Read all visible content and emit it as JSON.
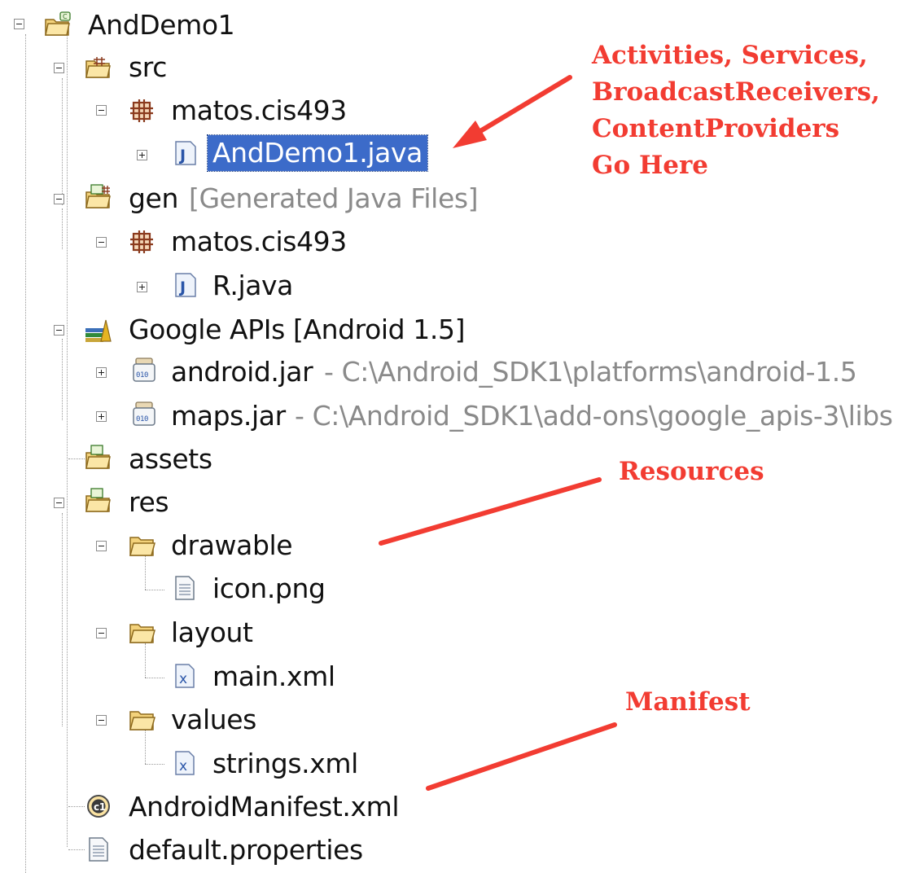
{
  "tree": {
    "project": "AndDemo1",
    "src": {
      "label": "src",
      "package": "matos.cis493",
      "file": "AndDemo1.java"
    },
    "gen": {
      "label": "gen",
      "decoration": "[Generated Java Files]",
      "package": "matos.cis493",
      "file": "R.java"
    },
    "library": {
      "label": "Google APIs [Android 1.5]",
      "jars": [
        {
          "name": "android.jar",
          "path": "- C:\\Android_SDK1\\platforms\\android-1.5"
        },
        {
          "name": "maps.jar",
          "path": "- C:\\Android_SDK1\\add-ons\\google_apis-3\\libs"
        }
      ]
    },
    "assets": "assets",
    "res": {
      "label": "res",
      "folders": [
        {
          "name": "drawable",
          "file": "icon.png"
        },
        {
          "name": "layout",
          "file": "main.xml"
        },
        {
          "name": "values",
          "file": "strings.xml"
        }
      ]
    },
    "manifest": "AndroidManifest.xml",
    "properties": "default.properties"
  },
  "annotations": {
    "activities": [
      "Activities, Services,",
      "BroadcastReceivers,",
      "ContentProviders",
      "Go Here"
    ],
    "resources": "Resources",
    "manifest": "Manifest"
  },
  "colors": {
    "annotation": "#f23c32",
    "selection": "#3c6bc9",
    "decoration": "#8a8a8a"
  }
}
